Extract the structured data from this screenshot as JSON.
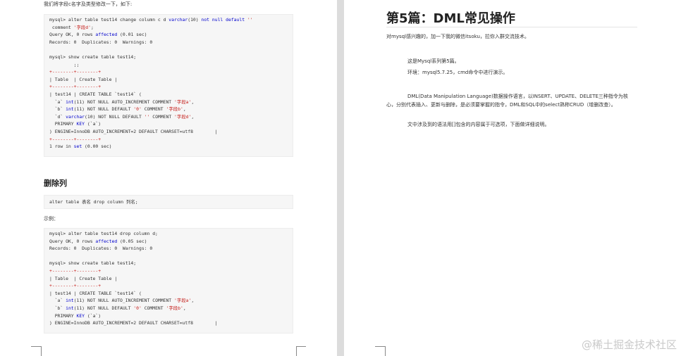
{
  "left_page": {
    "intro": "我们将字段c名字及类型修改一下，如下:",
    "code_block_1": [
      "mysql> alter table test14 change column c d varchar(10) not null default ''",
      " comment '字段d';",
      "Query OK, 0 rows affected (0.01 sec)",
      "Records: 0  Duplicates: 0  Warnings: 0",
      "",
      "mysql> show create table test14;",
      "         ;;",
      "+--------+--------+",
      "| Table  | Create Table |",
      "+--------+--------+",
      "| test14 | CREATE TABLE `test14` (",
      "  `a` int(11) NOT NULL AUTO_INCREMENT COMMENT '字段a',",
      "  `b` int(11) NOT NULL DEFAULT '0' COMMENT '字段b',",
      "  `d` varchar(10) NOT NULL DEFAULT '' COMMENT '字段d',",
      "  PRIMARY KEY (`a`)",
      ") ENGINE=InnoDB AUTO_INCREMENT=2 DEFAULT CHARSET=utf8        |",
      "+--------+--------+",
      "1 row in set (0.00 sec)"
    ],
    "section_heading": "删除列",
    "code_block_2": "alter table 表名 drop column 列名;",
    "example_label": "示例：",
    "code_block_3": [
      "mysql> alter table test14 drop column d;",
      "Query OK, 0 rows affected (0.05 sec)",
      "Records: 0  Duplicates: 0  Warnings: 0",
      "",
      "mysql> show create table test14;",
      "+--------+--------+",
      "| Table  | Create Table |",
      "+--------+--------+",
      "| test14 | CREATE TABLE `test14` (",
      "  `a` int(11) NOT NULL AUTO_INCREMENT COMMENT '字段a',",
      "  `b` int(11) NOT NULL DEFAULT '0' COMMENT '字段b',",
      "  PRIMARY KEY (`a`)",
      ") ENGINE=InnoDB AUTO_INCREMENT=2 DEFAULT CHARSET=utf8        |"
    ]
  },
  "right_page": {
    "title": "第5篇：DML常见操作",
    "para_1": "对mysql感兴趣的，加一下我的微信itsoku，拉你入群交流技术。",
    "para_2": "这是Mysql系列第5篇。",
    "para_3": "环境：mysql5.7.25，cmd命令中进行演示。",
    "para_4": "DML(Data Manipulation Language)数据操作语言，以INSERT、UPDATE、DELETE三种指令为核心，分别代表插入、更新与删除，是必须要掌握的指令，DML和SQL中的select熟称CRUD（增删改查）。",
    "para_5": "文中涉及到的语法用[]包含的内容属于可选项，下面做详细说明。"
  },
  "watermark": "@稀土掘金技术社区"
}
